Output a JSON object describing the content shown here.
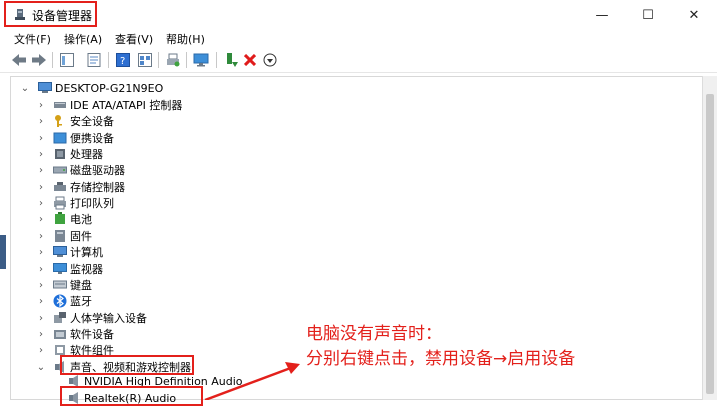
{
  "window": {
    "title": "设备管理器",
    "controls": {
      "minimize": "—",
      "maximize": "☐",
      "close": "✕"
    }
  },
  "menu": [
    {
      "label": "文件(F)"
    },
    {
      "label": "操作(A)"
    },
    {
      "label": "查看(V)"
    },
    {
      "label": "帮助(H)"
    }
  ],
  "tree": {
    "root": "DESKTOP-G21N9EO",
    "categories": [
      {
        "label": "IDE ATA/ATAPI 控制器",
        "icon": "ide-controller-icon"
      },
      {
        "label": "安全设备",
        "icon": "security-device-icon"
      },
      {
        "label": "便携设备",
        "icon": "portable-device-icon"
      },
      {
        "label": "处理器",
        "icon": "processor-icon"
      },
      {
        "label": "磁盘驱动器",
        "icon": "disk-drive-icon"
      },
      {
        "label": "存储控制器",
        "icon": "storage-controller-icon"
      },
      {
        "label": "打印队列",
        "icon": "printer-icon"
      },
      {
        "label": "电池",
        "icon": "battery-icon"
      },
      {
        "label": "固件",
        "icon": "firmware-icon"
      },
      {
        "label": "计算机",
        "icon": "computer-icon"
      },
      {
        "label": "监视器",
        "icon": "monitor-icon"
      },
      {
        "label": "键盘",
        "icon": "keyboard-icon"
      },
      {
        "label": "蓝牙",
        "icon": "bluetooth-icon"
      },
      {
        "label": "人体学输入设备",
        "icon": "hid-icon"
      },
      {
        "label": "软件设备",
        "icon": "software-device-icon"
      },
      {
        "label": "软件组件",
        "icon": "software-component-icon"
      },
      {
        "label": "声音、视频和游戏控制器",
        "icon": "sound-icon"
      }
    ],
    "audio_children": [
      {
        "label": "NVIDIA High Definition Audio"
      },
      {
        "label": "Realtek(R) Audio"
      }
    ]
  },
  "annotation": {
    "line1": "电脑没有声音时：",
    "line2": "分别右键点击，禁用设备→启用设备"
  },
  "colors": {
    "accent": "#e3201b"
  }
}
